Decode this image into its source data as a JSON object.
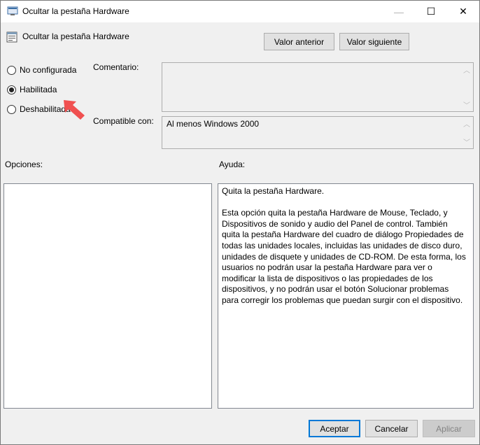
{
  "window": {
    "title": "Ocultar la pestaña Hardware",
    "minimize_label": "—",
    "maximize_label": "☐",
    "close_label": "✕"
  },
  "header": {
    "policy_title": "Ocultar la pestaña Hardware",
    "prev_button": "Valor anterior",
    "next_button": "Valor siguiente"
  },
  "state": {
    "options": [
      {
        "label": "No configurada",
        "checked": false
      },
      {
        "label": "Habilitada",
        "checked": true
      },
      {
        "label": "Deshabilitada",
        "checked": false
      }
    ]
  },
  "comment": {
    "label": "Comentario:",
    "value": ""
  },
  "supported": {
    "label": "Compatible con:",
    "value": "Al menos Windows 2000"
  },
  "options_section": {
    "label": "Opciones:"
  },
  "help_section": {
    "label": "Ayuda:",
    "text": "Quita la pestaña Hardware.\n\nEsta opción quita la pestaña Hardware de Mouse, Teclado, y\nDispositivos de sonido y audio del Panel de control. También\nquita la pestaña Hardware del cuadro de diálogo Propiedades de\ntodas las unidades locales, incluidas las unidades de disco duro,\nunidades de disquete y unidades de CD-ROM. De esta forma, los\nusuarios no podrán usar la pestaña Hardware para ver o\nmodificar la lista de dispositivos o las propiedades de los\ndispositivos, y no podrán usar el botón Solucionar problemas\npara corregir los problemas que puedan surgir con el dispositivo."
  },
  "footer": {
    "accept": "Aceptar",
    "cancel": "Cancelar",
    "apply": "Aplicar"
  },
  "icons": {
    "window_icon": "policy-window-icon",
    "header_icon": "policy-setting-icon",
    "annotation": "red-arrow-icon"
  },
  "colors": {
    "annotation_arrow": "#f05050",
    "default_button_border": "#0078d7"
  }
}
